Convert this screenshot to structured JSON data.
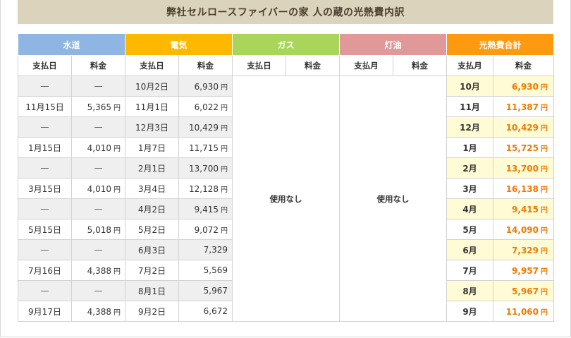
{
  "title": "弊社セルロースファイバーの家 人の蔵の光熱費内訳",
  "groups": [
    {
      "label": "水道",
      "color": "#8fb5e2"
    },
    {
      "label": "電気",
      "color": "#ffb800"
    },
    {
      "label": "ガス",
      "color": "#a8d55a"
    },
    {
      "label": "灯油",
      "color": "#e09898"
    },
    {
      "label": "光熱費合計",
      "color": "#ff9a10"
    }
  ],
  "subheaders": [
    "支払日",
    "料金",
    "支払日",
    "料金",
    "支払日",
    "料金",
    "支払月",
    "料金",
    "支払月",
    "料金"
  ],
  "unused_label": "使用なし",
  "yen": "円",
  "rows": [
    {
      "w_date": "—",
      "w_fee": "—",
      "w_yen": "",
      "e_date": "10月2日",
      "e_fee": "6,930",
      "e_yen": "円",
      "t_month": "10月",
      "t_fee": "6,930",
      "t_yen": "円"
    },
    {
      "w_date": "11月15日",
      "w_fee": "5,365",
      "w_yen": "円",
      "e_date": "11月1日",
      "e_fee": "6,022",
      "e_yen": "円",
      "t_month": "11月",
      "t_fee": "11,387",
      "t_yen": "円"
    },
    {
      "w_date": "—",
      "w_fee": "—",
      "w_yen": "",
      "e_date": "12月3日",
      "e_fee": "10,429",
      "e_yen": "円",
      "t_month": "12月",
      "t_fee": "10,429",
      "t_yen": "円"
    },
    {
      "w_date": "1月15日",
      "w_fee": "4,010",
      "w_yen": "円",
      "e_date": "1月7日",
      "e_fee": "11,715",
      "e_yen": "円",
      "t_month": "1月",
      "t_fee": "15,725",
      "t_yen": "円"
    },
    {
      "w_date": "—",
      "w_fee": "—",
      "w_yen": "",
      "e_date": "2月1日",
      "e_fee": "13,700",
      "e_yen": "円",
      "t_month": "2月",
      "t_fee": "13,700",
      "t_yen": "円"
    },
    {
      "w_date": "3月15日",
      "w_fee": "4,010",
      "w_yen": "円",
      "e_date": "3月4日",
      "e_fee": "12,128",
      "e_yen": "円",
      "t_month": "3月",
      "t_fee": "16,138",
      "t_yen": "円"
    },
    {
      "w_date": "—",
      "w_fee": "—",
      "w_yen": "",
      "e_date": "4月2日",
      "e_fee": "9,415",
      "e_yen": "円",
      "t_month": "4月",
      "t_fee": "9,415",
      "t_yen": "円"
    },
    {
      "w_date": "5月15日",
      "w_fee": "5,018",
      "w_yen": "円",
      "e_date": "5月2日",
      "e_fee": "9,072",
      "e_yen": "円",
      "t_month": "5月",
      "t_fee": "14,090",
      "t_yen": "円"
    },
    {
      "w_date": "—",
      "w_fee": "—",
      "w_yen": "",
      "e_date": "6月3日",
      "e_fee": "7,329",
      "e_yen": "",
      "t_month": "6月",
      "t_fee": "7,329",
      "t_yen": "円"
    },
    {
      "w_date": "7月16日",
      "w_fee": "4,388",
      "w_yen": "円",
      "e_date": "7月2日",
      "e_fee": "5,569",
      "e_yen": "",
      "t_month": "7月",
      "t_fee": "9,957",
      "t_yen": "円"
    },
    {
      "w_date": "—",
      "w_fee": "—",
      "w_yen": "",
      "e_date": "8月1日",
      "e_fee": "5,967",
      "e_yen": "",
      "t_month": "8月",
      "t_fee": "5,967",
      "t_yen": "円"
    },
    {
      "w_date": "9月17日",
      "w_fee": "4,388",
      "w_yen": "円",
      "e_date": "9月2日",
      "e_fee": "6,672",
      "e_yen": "",
      "t_month": "9月",
      "t_fee": "11,060",
      "t_yen": "円"
    }
  ]
}
